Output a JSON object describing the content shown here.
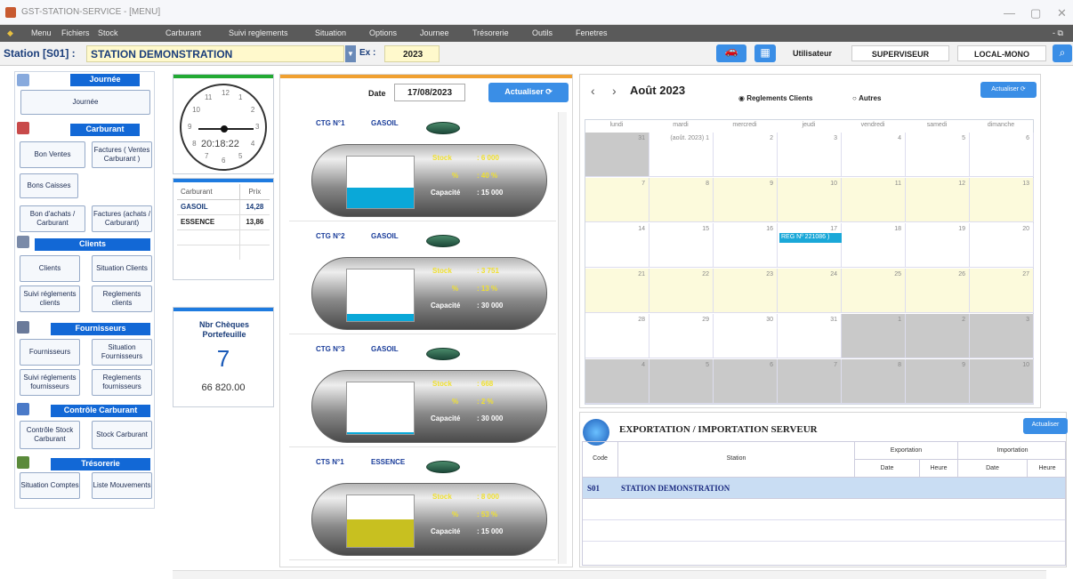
{
  "window": {
    "title": "GST-STATION-SERVICE - [MENU]",
    "min": "—",
    "max": "▢",
    "close": "✕"
  },
  "menu": [
    "Menu",
    "Fichiers",
    "Stock",
    "Carburant",
    "Suivi reglements",
    "Situation",
    "Options",
    "Journee",
    "Trésorerie",
    "Outils",
    "Fenetres"
  ],
  "menu_right": "- ⧉",
  "station": {
    "label": "Station [S01] :",
    "name": "STATION DEMONSTRATION",
    "ex_label": "Ex :",
    "ex_value": "2023",
    "user_label": "Utilisateur",
    "user": "SUPERVISEUR",
    "mode": "LOCAL-MONO"
  },
  "sidebar": {
    "journee": {
      "title": "Journée",
      "btn": "Journée"
    },
    "carburant": {
      "title": "Carburant",
      "b1": "Bon Ventes",
      "b2": "Factures ( Ventes Carburant )",
      "b3": "Bons Caisses",
      "b4": "Bon d'achats / Carburant",
      "b5": "Factures (achats / Carburant)"
    },
    "clients": {
      "title": "Clients",
      "b1": "Clients",
      "b2": "Situation Clients",
      "b3": "Suivi réglements clients",
      "b4": "Reglements clients"
    },
    "fournisseurs": {
      "title": "Fournisseurs",
      "b1": "Fournisseurs",
      "b2": "Situation Fournisseurs",
      "b3": "Suivi réglements fournisseurs",
      "b4": "Reglements fournisseurs"
    },
    "controle": {
      "title": "Contrôle Carburant",
      "b1": "Contrôle Stock Carburant",
      "b2": "Stock Carburant"
    },
    "tresorerie": {
      "title": "Trésorerie",
      "b1": "Situation Comptes",
      "b2": "Liste Mouvements"
    }
  },
  "clock": {
    "time": "20:18:22",
    "numbers": [
      "12",
      "1",
      "2",
      "3",
      "4",
      "5",
      "6",
      "7",
      "8",
      "9",
      "10",
      "11"
    ]
  },
  "prices": {
    "h1": "Carburant",
    "h2": "Prix",
    "rows": [
      {
        "name": "GASOIL",
        "price": "14,28"
      },
      {
        "name": "ESSENCE",
        "price": "13,86"
      }
    ]
  },
  "cheques": {
    "title": "Nbr Chèques Portefeuille",
    "count": "7",
    "amount": "66 820.00"
  },
  "tanks_panel": {
    "date_label": "Date",
    "date": "17/08/2023",
    "refresh": "Actualiser"
  },
  "tanks": [
    {
      "code": "CTG N°1",
      "fuel": "GASOIL",
      "stock_label": "Stock",
      "stock": ": 6 000",
      "pct_label": "%",
      "pct": ": 40 %",
      "cap_label": "Capacité",
      "cap": ": 15 000",
      "level": 0.4,
      "color": "#0aa8d8"
    },
    {
      "code": "CTG N°2",
      "fuel": "GASOIL",
      "stock_label": "Stock",
      "stock": ": 3 751",
      "pct_label": "%",
      "pct": ": 13 %",
      "cap_label": "Capacité",
      "cap": ": 30 000",
      "level": 0.13,
      "color": "#0aa8d8"
    },
    {
      "code": "CTG N°3",
      "fuel": "GASOIL",
      "stock_label": "Stock",
      "stock": ": 668",
      "pct_label": "%",
      "pct": ": 2 %",
      "cap_label": "Capacité",
      "cap": ": 30 000",
      "level": 0.02,
      "color": "#0aa8d8"
    },
    {
      "code": "CTS N°1",
      "fuel": "ESSENCE",
      "stock_label": "Stock",
      "stock": ": 8 000",
      "pct_label": "%",
      "pct": ": 53 %",
      "cap_label": "Capacité",
      "cap": ": 15 000",
      "level": 0.53,
      "color": "#c8c020"
    }
  ],
  "calendar": {
    "prev": "‹",
    "next": "›",
    "month": "Août 2023",
    "opt1": "Reglements Clients",
    "opt2": "Autres",
    "refresh": "Actualiser",
    "days": [
      "lundi",
      "mardi",
      "mercredi",
      "jeudi",
      "vendredi",
      "samedi",
      "dimanche"
    ],
    "weeks": [
      [
        "31",
        "(août. 2023) 1",
        "2",
        "3",
        "4",
        "5",
        "6"
      ],
      [
        "7",
        "8",
        "9",
        "10",
        "11",
        "12",
        "13"
      ],
      [
        "14",
        "15",
        "16",
        "17",
        "18",
        "19",
        "20"
      ],
      [
        "21",
        "22",
        "23",
        "24",
        "25",
        "26",
        "27"
      ],
      [
        "28",
        "29",
        "30",
        "31",
        "1",
        "2",
        "3"
      ],
      [
        "4",
        "5",
        "6",
        "7",
        "8",
        "9",
        "10"
      ]
    ],
    "event": "REG Nº 221086 )"
  },
  "export": {
    "title": "EXPORTATION / IMPORTATION SERVEUR",
    "refresh": "Actualiser",
    "h_code": "Code",
    "h_station": "Station",
    "h_exp": "Exportation",
    "h_imp": "Importation",
    "h_date": "Date",
    "h_heure": "Heure",
    "row": {
      "code": "S01",
      "station": "STATION DEMONSTRATION"
    }
  },
  "colors": {
    "accent": "#1268d6",
    "menubar": "#5a5a5a",
    "yellow": "#fff9cc"
  }
}
